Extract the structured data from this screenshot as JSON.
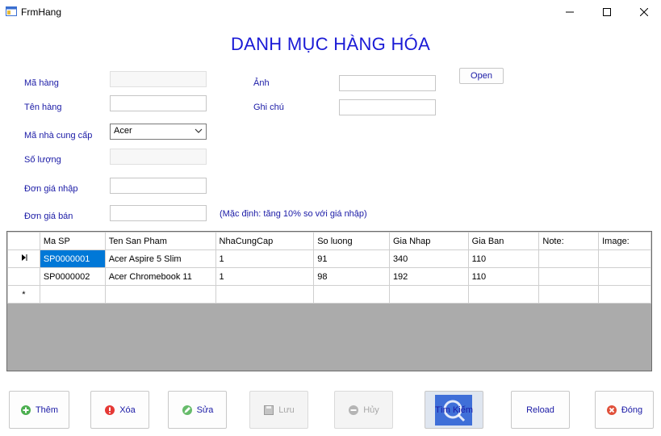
{
  "window": {
    "title": "FrmHang"
  },
  "page": {
    "title": "DANH MỤC HÀNG HÓA"
  },
  "form": {
    "ma_hang_label": "Mã hàng",
    "ten_hang_label": "Tên hàng",
    "ma_ncc_label": "Mã nhà cung cấp",
    "so_luong_label": "Số lượng",
    "don_gia_nhap_label": "Đơn giá nhập",
    "don_gia_ban_label": "Đơn giá bán",
    "anh_label": "Ảnh",
    "ghi_chu_label": "Ghi chú",
    "ma_ncc_value": "Acer",
    "hint": "(Mặc định: tăng 10% so với giá nhập)",
    "open_label": "Open"
  },
  "grid": {
    "columns": [
      "Ma SP",
      "Ten San Pham",
      "NhaCungCap",
      "So luong",
      "Gia Nhap",
      "Gia Ban",
      "Note:",
      "Image:"
    ],
    "rows": [
      [
        "SP0000001",
        "Acer Aspire 5 Slim",
        "1",
        "91",
        "340",
        "110",
        "",
        ""
      ],
      [
        "SP0000002",
        "Acer Chromebook 11",
        "1",
        "98",
        "192",
        "110",
        "",
        ""
      ]
    ],
    "new_row_marker": "*"
  },
  "buttons": {
    "them": "Thêm",
    "xoa": "Xóa",
    "sua": "Sửa",
    "luu": "Lưu",
    "huy": "Hủy",
    "tim_kiem": "Tìm Kiếm",
    "reload": "Reload",
    "dong": "Đóng"
  },
  "colors": {
    "title": "#1a1ad6",
    "label": "#1a1aa6",
    "selection": "#0078d7"
  }
}
